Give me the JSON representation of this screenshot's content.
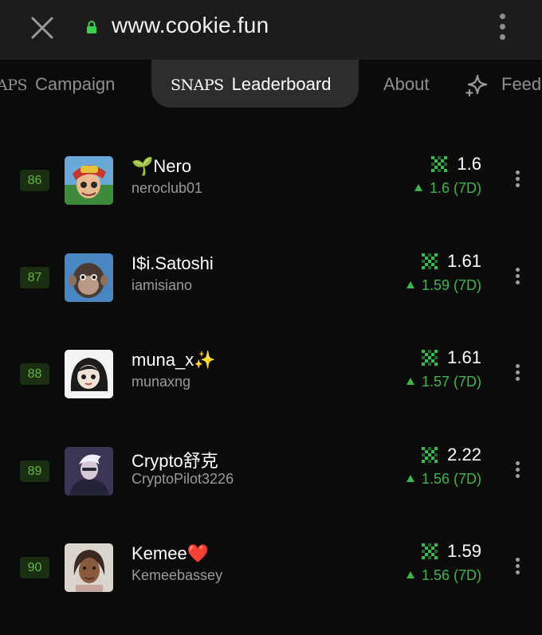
{
  "browser": {
    "url": "www.cookie.fun",
    "close_icon": "close-icon",
    "lock_icon": "lock-icon",
    "menu_icon": "kebab-menu-icon"
  },
  "tabs": {
    "items": [
      {
        "prefix": "APS",
        "label": "Campaign"
      },
      {
        "prefix": "SNAPS",
        "label": "Leaderboard",
        "active": true
      },
      {
        "prefix": "",
        "label": "About"
      },
      {
        "prefix": "",
        "label": "Feed",
        "icon": "sparkle-icon"
      }
    ]
  },
  "leaderboard": {
    "rows": [
      {
        "rank": "86",
        "name": "🌱Nero",
        "handle": "neroclub01",
        "score": "1.6",
        "change": "1.6 (7D)"
      },
      {
        "rank": "87",
        "name": "I$i.Satoshi",
        "handle": "iamisiano",
        "score": "1.61",
        "change": "1.59 (7D)"
      },
      {
        "rank": "88",
        "name": "muna_x✨",
        "handle": "munaxng",
        "score": "1.61",
        "change": "1.57 (7D)"
      },
      {
        "rank": "89",
        "name": "Crypto舒克",
        "handle": "CryptoPilot3226",
        "score": "2.22",
        "change": "1.56 (7D)"
      },
      {
        "rank": "90",
        "name": "Kemee❤️",
        "handle": "Kemeebassey",
        "score": "1.59",
        "change": "1.56 (7D)"
      }
    ]
  },
  "colors": {
    "accent_green": "#3fb64d",
    "rank_badge_bg": "#1a2f12",
    "rank_badge_text": "#61b83b",
    "active_tab_bg": "#2d2d2d"
  }
}
